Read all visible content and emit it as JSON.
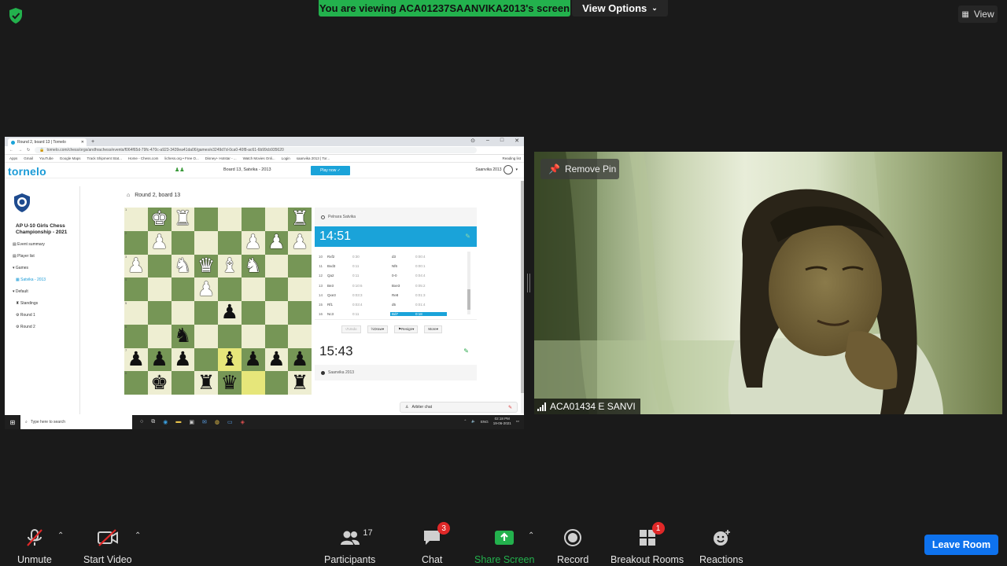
{
  "top_bar": {
    "viewing_banner": "You are viewing ACA01237SAANVIKA2013's screen",
    "view_options_label": "View Options",
    "view_label": "View",
    "colors": {
      "banner": "#23b14d",
      "security": "#23b14d"
    }
  },
  "shared_screen": {
    "browser": {
      "tab_title": "Round 2, board 13 | Tornelo",
      "url": "tornelo.com/chess/orgs/andhrachess/events/f064f65d-79fc-470c-a923-3439ea41da06/games/e3249d7d-0ca0-40f8-ac61-6b99cb935620",
      "bookmarks": [
        "Apps",
        "Gmail",
        "YouTube",
        "Google Maps",
        "Track Shipment Stat...",
        "Home - Chess.com",
        "lichess.org • Free O...",
        "Disney+ Hotstar - ...",
        "Watch Movies Onli...",
        "Login",
        "saanvika 2013 | Tor...",
        "Reading list"
      ]
    },
    "site": {
      "logo": "tornelo",
      "board_title": "Board 13, Satvika - 2013",
      "play_now": "Play now ✓",
      "user": "Saanvika 2013",
      "round_title": "Round 2, board 13",
      "sidebar": {
        "event_title": "AP U-10 Girls Chess Championship - 2021",
        "items": [
          {
            "label": "Event summary"
          },
          {
            "label": "Player list"
          },
          {
            "label": "Games"
          },
          {
            "label": "Satvika - 2013"
          },
          {
            "label": "Default"
          },
          {
            "label": "Standings"
          },
          {
            "label": "Round 1"
          },
          {
            "label": "Round 2"
          }
        ]
      },
      "board": {
        "rows": [
          [
            " ",
            "wk",
            "wr",
            " ",
            " ",
            " ",
            " ",
            "wr"
          ],
          [
            " ",
            "wp",
            " ",
            " ",
            " ",
            "wp",
            "wp",
            "wp"
          ],
          [
            "wp",
            " ",
            "wn",
            "wq",
            "wb",
            "wn",
            " ",
            " "
          ],
          [
            " ",
            " ",
            " ",
            "wp",
            " ",
            " ",
            " ",
            " "
          ],
          [
            " ",
            " ",
            " ",
            " ",
            "bp",
            " ",
            " ",
            " "
          ],
          [
            " ",
            " ",
            "bn",
            " ",
            " ",
            " ",
            " ",
            " "
          ],
          [
            "bp",
            "bp",
            "bp",
            " ",
            "bb",
            "bp",
            "bp",
            "bp"
          ],
          [
            " ",
            "bk",
            " ",
            "br",
            "bq",
            " ",
            " ",
            "br"
          ]
        ],
        "highlights": [
          "6-4",
          "7-5"
        ],
        "rank_labels": [
          "1",
          "2",
          "3",
          "4",
          "5",
          "6",
          "7",
          "8"
        ]
      },
      "opponent": {
        "name": "Pelnara Satvika",
        "clock": "14:51"
      },
      "moves": [
        {
          "n": "10",
          "w": "Rxf2",
          "wt": "0:30",
          "b": "d3",
          "bt": "0:00:4"
        },
        {
          "n": "11",
          "w": "Bxd3",
          "wt": "0:11",
          "b": "Nf6",
          "bt": "0:00:1"
        },
        {
          "n": "12",
          "w": "Qa2",
          "wt": "0:11",
          "b": "0-0",
          "bt": "0:04:4"
        },
        {
          "n": "13",
          "w": "Be3",
          "wt": "0:10:6",
          "b": "Bxe3",
          "bt": "0:05:2"
        },
        {
          "n": "14",
          "w": "Qxe3",
          "wt": "0:03:3",
          "b": "Re8",
          "bt": "0:01:3"
        },
        {
          "n": "15",
          "w": "Rf1",
          "wt": "0:03:4",
          "b": "d5",
          "bt": "0:01:4"
        },
        {
          "n": "16",
          "w": "Nc3",
          "wt": "0:11",
          "b": "Bd7",
          "bt": "0:18",
          "current": true
        }
      ],
      "actions": [
        "Undo",
        "Draw",
        "Resign",
        "More"
      ],
      "me": {
        "name": "Saanvika 2013",
        "clock": "15:43"
      },
      "arbiter_chat": "Arbiter chat"
    },
    "taskbar": {
      "search_placeholder": "Type here to search",
      "tray_lang": "ENG",
      "time": "02:18 PM",
      "date": "19-06-2021"
    }
  },
  "video": {
    "remove_pin": "Remove Pin",
    "participant_name": "ACA01434 E SANVI"
  },
  "toolbar": {
    "unmute": "Unmute",
    "start_video": "Start Video",
    "participants": "Participants",
    "participants_count": "17",
    "chat": "Chat",
    "chat_badge": "3",
    "share_screen": "Share Screen",
    "record": "Record",
    "breakout_rooms": "Breakout Rooms",
    "breakout_badge": "1",
    "reactions": "Reactions",
    "leave_room": "Leave Room",
    "colors": {
      "share": "#23b14d",
      "leave": "#0e72ed",
      "badge": "#e02828"
    }
  }
}
